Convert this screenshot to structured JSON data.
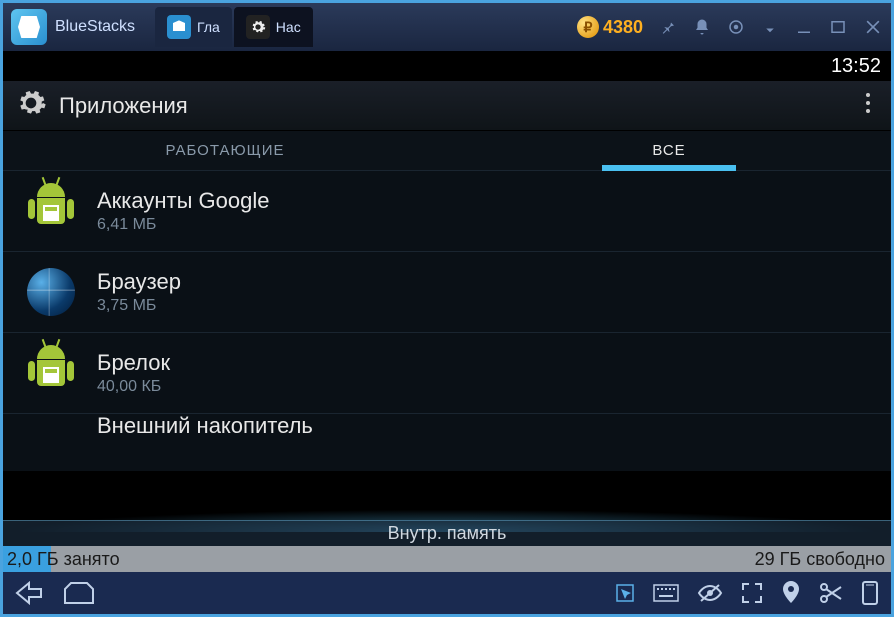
{
  "titlebar": {
    "app_name": "BlueStacks",
    "tabs": [
      {
        "label": "Гла",
        "icon": "home"
      },
      {
        "label": "Нас",
        "icon": "settings"
      }
    ],
    "coin_symbol": "₽",
    "coin_value": "4380"
  },
  "status_bar": {
    "time": "13:52"
  },
  "action_bar": {
    "title": "Приложения"
  },
  "app_tabs": {
    "running": "РАБОТАЮЩИЕ",
    "all": "ВСЕ"
  },
  "apps": [
    {
      "name": "Аккаунты Google",
      "size": "6,41 МБ",
      "icon": "android-box"
    },
    {
      "name": "Браузер",
      "size": "3,75 МБ",
      "icon": "globe"
    },
    {
      "name": "Брелок",
      "size": "40,00 КБ",
      "icon": "android-box"
    },
    {
      "name": "Внешний накопитель",
      "size": "",
      "icon": "android"
    }
  ],
  "storage": {
    "label": "Внутр. память",
    "used": "2,0 ГБ занято",
    "free": "29 ГБ свободно"
  }
}
